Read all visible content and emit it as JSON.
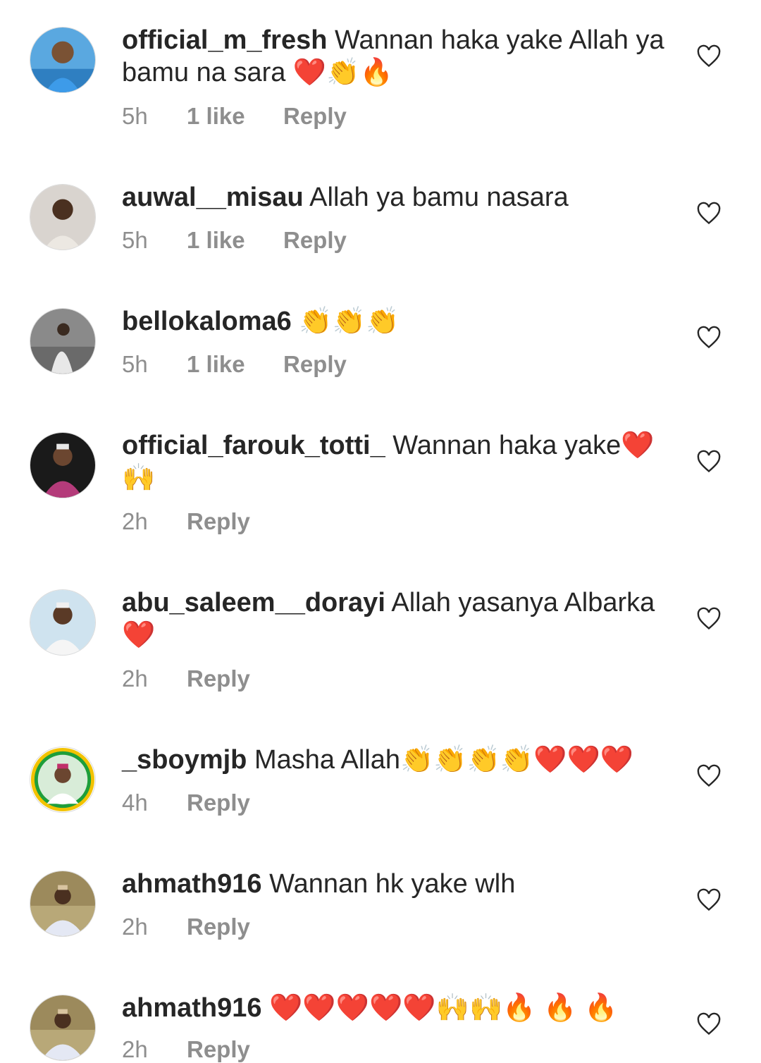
{
  "comments": [
    {
      "username": "official_m_fresh",
      "text": "Wannan haka yake Allah ya bamu na sara ❤️👏🔥",
      "time": "5h",
      "likes": "1 like",
      "reply": "Reply"
    },
    {
      "username": "auwal__misau",
      "text": "Allah ya bamu nasara",
      "time": "5h",
      "likes": "1 like",
      "reply": "Reply"
    },
    {
      "username": "bellokaloma6",
      "text": "👏👏👏",
      "time": "5h",
      "likes": "1 like",
      "reply": "Reply"
    },
    {
      "username": "official_farouk_totti_",
      "text": "Wannan haka yake❤️ 🙌",
      "time": "2h",
      "likes": "",
      "reply": "Reply"
    },
    {
      "username": "abu_saleem__dorayi",
      "text": "Allah yasanya Albarka ❤️",
      "time": "2h",
      "likes": "",
      "reply": "Reply"
    },
    {
      "username": "_sboymjb",
      "text": "Masha Allah👏👏👏👏❤️❤️❤️",
      "time": "4h",
      "likes": "",
      "reply": "Reply"
    },
    {
      "username": "ahmath916",
      "text": "Wannan hk yake wlh",
      "time": "2h",
      "likes": "",
      "reply": "Reply"
    },
    {
      "username": "ahmath916",
      "text": "❤️❤️❤️❤️❤️🙌🙌🔥 🔥 🔥",
      "time": "2h",
      "likes": "",
      "reply": "Reply"
    }
  ],
  "colors": {
    "text": "#262626",
    "meta": "#8e8e8e",
    "background": "#ffffff"
  },
  "icons": {
    "like": "heart-outline-icon"
  }
}
